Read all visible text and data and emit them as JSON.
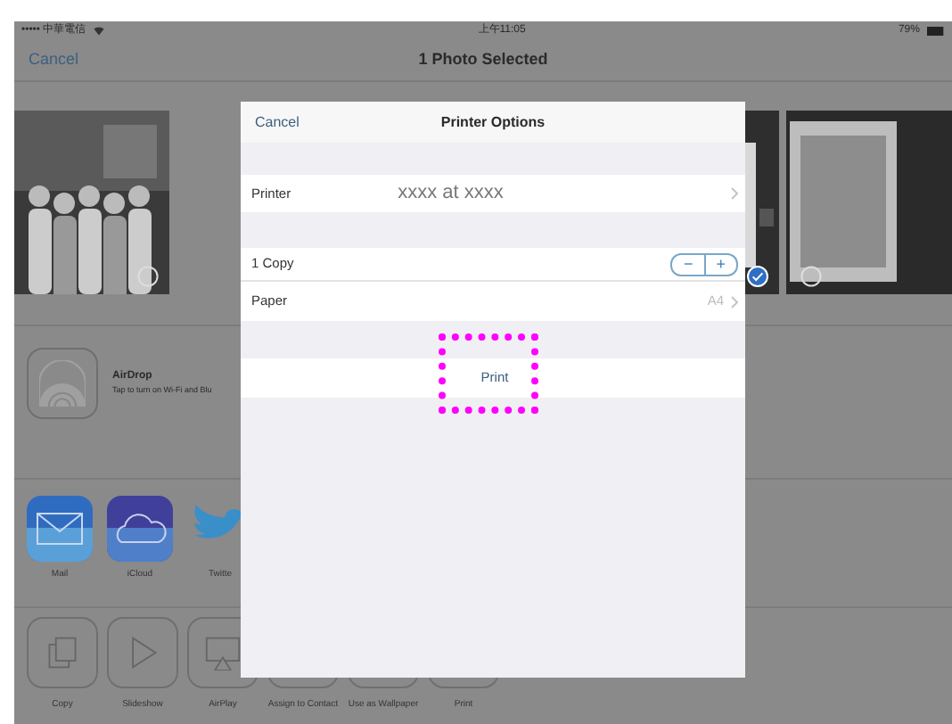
{
  "status_bar": {
    "carrier": "••••• 中華電信",
    "time": "上午11:05",
    "battery": "79%"
  },
  "nav": {
    "cancel": "Cancel",
    "title": "1 Photo Selected"
  },
  "photos": [
    {
      "selected": false
    },
    {
      "selected": true
    },
    {
      "selected": false
    }
  ],
  "airdrop": {
    "title": "AirDrop",
    "subtitle": "Tap to turn on Wi-Fi and Blu"
  },
  "share_apps": [
    {
      "kind": "mail",
      "label": "Mail"
    },
    {
      "kind": "icloud",
      "label": "iCloud"
    },
    {
      "kind": "bird",
      "label": "Twitte"
    }
  ],
  "actions": [
    {
      "kind": "copy",
      "label": "Copy"
    },
    {
      "kind": "play",
      "label": "Slideshow"
    },
    {
      "kind": "airplay",
      "label": "AirPlay"
    },
    {
      "kind": "tile",
      "label": "Assign to Contact"
    },
    {
      "kind": "tile",
      "label": "Use as Wallpaper"
    },
    {
      "kind": "tile",
      "label": "Print"
    }
  ],
  "printer_options": {
    "cancel": "Cancel",
    "title": "Printer Options",
    "printer_label": "Printer",
    "printer_value": "xxxx at xxxx",
    "copies": "1 Copy",
    "minus": "−",
    "plus": "+",
    "paper_label": "Paper",
    "paper_value": "A4",
    "print": "Print",
    "highlighted": true
  }
}
